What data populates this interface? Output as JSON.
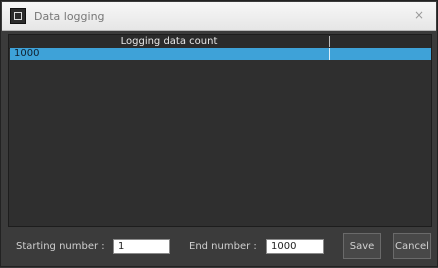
{
  "window": {
    "title": "Data logging",
    "close_glyph": "×"
  },
  "grid": {
    "column_header": "Logging data count",
    "rows": [
      {
        "value": "1000"
      }
    ]
  },
  "footer": {
    "start_label": "Starting number :",
    "start_value": "1",
    "end_label": "End number :",
    "end_value": "1000",
    "save_label": "Save",
    "cancel_label": "Cancel"
  },
  "colors": {
    "selection": "#3ea2d8",
    "background": "#3b3b3b"
  },
  "icons": {
    "app": "app-window-icon",
    "close": "close-icon"
  }
}
